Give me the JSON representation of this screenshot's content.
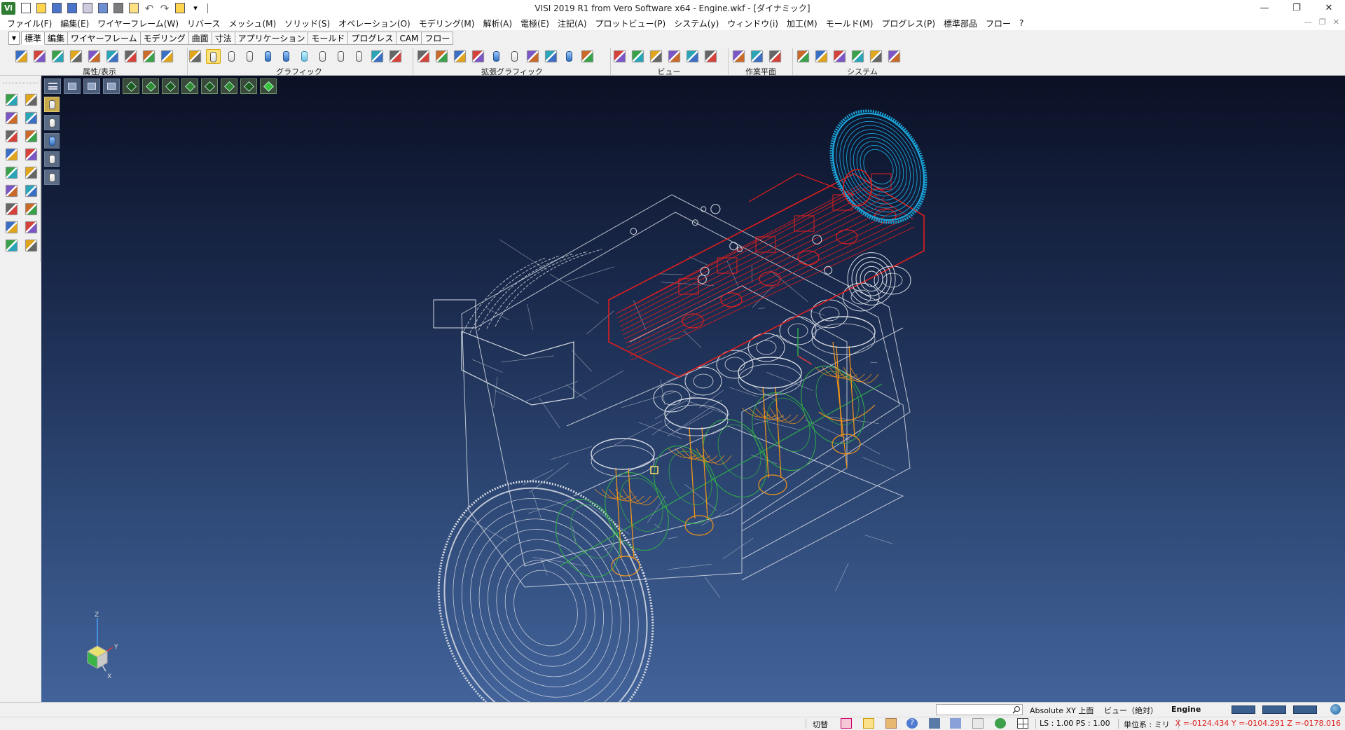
{
  "window": {
    "title": "VISI 2019 R1 from Vero Software x64 - Engine.wkf - [ダイナミック]",
    "app_logo": "Vi",
    "controls": [
      "minimize-icon",
      "restore-icon",
      "close-icon"
    ]
  },
  "quick_access": [
    "new-file-icon",
    "open-file-icon",
    "save-icon",
    "save-as-icon",
    "print-preview-icon",
    "plot-icon",
    "print-icon",
    "zoom-search-icon",
    "undo-icon",
    "redo-icon",
    "undo-history-icon",
    "customize-dropdown-icon"
  ],
  "menu": [
    "ファイル(F)",
    "編集(E)",
    "ワイヤーフレーム(W)",
    "リバース",
    "メッシュ(M)",
    "ソリッド(S)",
    "オペレーション(O)",
    "モデリング(M)",
    "解析(A)",
    "電極(E)",
    "注記(A)",
    "プロットビュー(P)",
    "システム(y)",
    "ウィンドウ(i)",
    "加工(M)",
    "モールド(M)",
    "プログレス(P)",
    "標準部品",
    "フロー",
    "?"
  ],
  "ribbon": {
    "tabs": [
      "標準",
      "編集",
      "ワイヤーフレーム",
      "モデリング",
      "曲面",
      "寸法",
      "アプリケーション",
      "モールド",
      "プログレス",
      "CAM",
      "フロー"
    ],
    "active_tab": "標準",
    "groups": [
      {
        "label": "属性/表示",
        "icons": [
          "attributes-icon",
          "layer-icon",
          "show-hide-icon",
          "hide-icon",
          "visibility-icon",
          "color-icon",
          "line-style-icon",
          "show-all-icon",
          "show-icon"
        ]
      },
      {
        "label": "グラフィック",
        "icons": [
          "redraw-icon",
          "wireframe-cylinder-icon",
          "hidden-line-cylinder-icon",
          "silhouette-cylinder-icon",
          "shaded-cylinder-icon",
          "shaded-edges-cylinder-icon",
          "transparent-cylinder-icon",
          "outline-cylinder-icon",
          "mesh-cylinder-icon",
          "multi-cylinder-icon",
          "edge-style-icon",
          "render-settings-icon"
        ]
      },
      {
        "label": "拡張グラフィック",
        "icons": [
          "explode-icon",
          "analysis-icon",
          "section-icon",
          "dynamic-section-icon",
          "shaded-cylinder-icon",
          "cylinder-icon",
          "section-view-icon",
          "clip-icon",
          "cylinder-blue-icon",
          "box-icon"
        ]
      },
      {
        "label": "ビュー",
        "icons": [
          "view-manager-icon",
          "view-rotate-icon",
          "view-fit-icon",
          "view-axis-icon",
          "refresh-view-icon",
          "eye-view-icon"
        ]
      },
      {
        "label": "作業平面",
        "icons": [
          "workplane-icon",
          "workplane-origin-icon",
          "workplane-axis-icon"
        ]
      },
      {
        "label": "システム",
        "icons": [
          "color-palette-icon",
          "settings-window-icon",
          "globe-icon",
          "image-icon",
          "texture-icon",
          "material-icon"
        ]
      }
    ]
  },
  "left_toolbox": [
    "select-entity-icon",
    "edit-points-icon",
    "box-select-icon",
    "measure-icon",
    "group-select-icon",
    "verify-icon",
    "attributes-query-icon",
    "edit-icon",
    "layer-assign-icon",
    "plane-icon",
    "rotate-icon",
    "solid-box-icon",
    "help-query-icon",
    "dimension-icon",
    "delete-icon",
    "undo-icon",
    "color-wheel-icon",
    "folder-icon"
  ],
  "viewport": {
    "top_toolbar": [
      "menu-lines-icon",
      "window-icon",
      "zoom-icon",
      "pan-icon",
      "iso-cube-icon",
      "front-cube-icon",
      "side-cube-icon",
      "top-cube-icon",
      "right-cube-icon",
      "back-cube-icon",
      "bottom-cube-icon",
      "shaded-cube-icon"
    ],
    "side_toolbar": [
      "wireframe-cylinder-icon",
      "hidden-cylinder-icon",
      "shaded-cylinder-icon",
      "edged-cylinder-icon",
      "mesh-cylinder-icon"
    ],
    "model_colors": {
      "cam_cover": "#e01e1e",
      "timing_gear": "#19a3d8",
      "pistons_rods": "#f0941a",
      "crankshaft": "#2fa84a",
      "block": "#d8dce4"
    },
    "background": {
      "top": "#0b1024",
      "bottom": "#42639a"
    },
    "axes": {
      "z": "Z",
      "y": "Y",
      "x": "X"
    }
  },
  "status": {
    "search_placeholder": "",
    "plane": "Absolute XY 上面",
    "view": "ビュー（絶対）",
    "layer": "Engine",
    "toggle": "切替",
    "scale": "LS : 1.00 PS : 1.00",
    "units": "単位系 : ミリ",
    "coordinates": "X =-0124.434 Y =-0104.291 Z =-0178.016"
  }
}
